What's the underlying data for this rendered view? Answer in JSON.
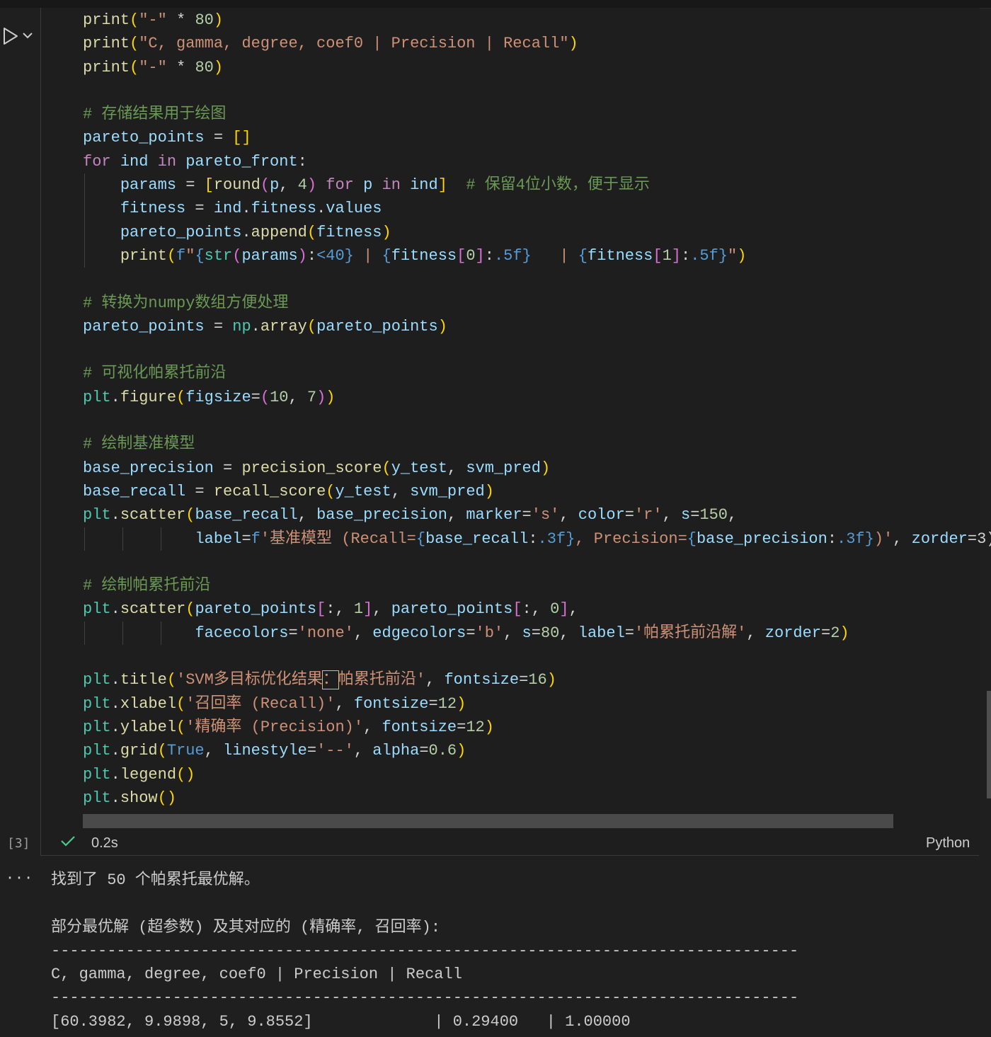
{
  "code_lines": [
    {
      "indent": 0,
      "segments": [
        [
          "f",
          "print"
        ],
        [
          "y",
          "("
        ],
        [
          "s",
          "\"-\""
        ],
        [
          "o",
          " * "
        ],
        [
          "n",
          "80"
        ],
        [
          "y",
          ")"
        ]
      ]
    },
    {
      "indent": 0,
      "segments": [
        [
          "f",
          "print"
        ],
        [
          "y",
          "("
        ],
        [
          "s",
          "\"C, gamma, degree, coef0 | Precision | Recall\""
        ],
        [
          "y",
          ")"
        ]
      ]
    },
    {
      "indent": 0,
      "segments": [
        [
          "f",
          "print"
        ],
        [
          "y",
          "("
        ],
        [
          "s",
          "\"-\""
        ],
        [
          "o",
          " * "
        ],
        [
          "n",
          "80"
        ],
        [
          "y",
          ")"
        ]
      ]
    },
    {
      "indent": 0,
      "segments": []
    },
    {
      "indent": 0,
      "segments": [
        [
          "c",
          "# 存储结果用于绘图"
        ]
      ]
    },
    {
      "indent": 0,
      "segments": [
        [
          "v",
          "pareto_points"
        ],
        [
          "o",
          " = "
        ],
        [
          "y",
          "[]"
        ]
      ]
    },
    {
      "indent": 0,
      "segments": [
        [
          "k",
          "for"
        ],
        [
          "o",
          " "
        ],
        [
          "v",
          "ind"
        ],
        [
          "o",
          " "
        ],
        [
          "k",
          "in"
        ],
        [
          "o",
          " "
        ],
        [
          "v",
          "pareto_front"
        ],
        [
          "o",
          ":"
        ]
      ]
    },
    {
      "indent": 1,
      "segments": [
        [
          "v",
          "params"
        ],
        [
          "o",
          " = "
        ],
        [
          "y",
          "["
        ],
        [
          "f",
          "round"
        ],
        [
          "m",
          "("
        ],
        [
          "v",
          "p"
        ],
        [
          "o",
          ", "
        ],
        [
          "n",
          "4"
        ],
        [
          "m",
          ")"
        ],
        [
          "o",
          " "
        ],
        [
          "k",
          "for"
        ],
        [
          "o",
          " "
        ],
        [
          "v",
          "p"
        ],
        [
          "o",
          " "
        ],
        [
          "k",
          "in"
        ],
        [
          "o",
          " "
        ],
        [
          "v",
          "ind"
        ],
        [
          "y",
          "]"
        ],
        [
          "o",
          "  "
        ],
        [
          "c",
          "# 保留4位小数，便于显示"
        ]
      ]
    },
    {
      "indent": 1,
      "segments": [
        [
          "v",
          "fitness"
        ],
        [
          "o",
          " = "
        ],
        [
          "v",
          "ind"
        ],
        [
          "o",
          "."
        ],
        [
          "v",
          "fitness"
        ],
        [
          "o",
          "."
        ],
        [
          "v",
          "values"
        ]
      ]
    },
    {
      "indent": 1,
      "segments": [
        [
          "v",
          "pareto_points"
        ],
        [
          "o",
          "."
        ],
        [
          "f",
          "append"
        ],
        [
          "y",
          "("
        ],
        [
          "v",
          "fitness"
        ],
        [
          "y",
          ")"
        ]
      ]
    },
    {
      "indent": 1,
      "segments": [
        [
          "f",
          "print"
        ],
        [
          "y",
          "("
        ],
        [
          "b",
          "f"
        ],
        [
          "s",
          "\""
        ],
        [
          "b",
          "{"
        ],
        [
          "t",
          "str"
        ],
        [
          "m",
          "("
        ],
        [
          "v",
          "params"
        ],
        [
          "m",
          ")"
        ],
        [
          "o",
          ":"
        ],
        [
          "b",
          "<40}"
        ],
        [
          "s",
          " | "
        ],
        [
          "b",
          "{"
        ],
        [
          "v",
          "fitness"
        ],
        [
          "m",
          "["
        ],
        [
          "n",
          "0"
        ],
        [
          "m",
          "]"
        ],
        [
          "o",
          ":"
        ],
        [
          "b",
          ".5f}"
        ],
        [
          "s",
          "   | "
        ],
        [
          "b",
          "{"
        ],
        [
          "v",
          "fitness"
        ],
        [
          "m",
          "["
        ],
        [
          "n",
          "1"
        ],
        [
          "m",
          "]"
        ],
        [
          "o",
          ":"
        ],
        [
          "b",
          ".5f}"
        ],
        [
          "s",
          "\""
        ],
        [
          "y",
          ")"
        ]
      ]
    },
    {
      "indent": 0,
      "segments": []
    },
    {
      "indent": 0,
      "segments": [
        [
          "c",
          "# 转换为numpy数组方便处理"
        ]
      ]
    },
    {
      "indent": 0,
      "segments": [
        [
          "v",
          "pareto_points"
        ],
        [
          "o",
          " = "
        ],
        [
          "t",
          "np"
        ],
        [
          "o",
          "."
        ],
        [
          "f",
          "array"
        ],
        [
          "y",
          "("
        ],
        [
          "v",
          "pareto_points"
        ],
        [
          "y",
          ")"
        ]
      ]
    },
    {
      "indent": 0,
      "segments": []
    },
    {
      "indent": 0,
      "segments": [
        [
          "c",
          "# 可视化帕累托前沿"
        ]
      ]
    },
    {
      "indent": 0,
      "segments": [
        [
          "t",
          "plt"
        ],
        [
          "o",
          "."
        ],
        [
          "f",
          "figure"
        ],
        [
          "y",
          "("
        ],
        [
          "v",
          "figsize"
        ],
        [
          "o",
          "="
        ],
        [
          "m",
          "("
        ],
        [
          "n",
          "10"
        ],
        [
          "o",
          ", "
        ],
        [
          "n",
          "7"
        ],
        [
          "m",
          ")"
        ],
        [
          "y",
          ")"
        ]
      ]
    },
    {
      "indent": 0,
      "segments": []
    },
    {
      "indent": 0,
      "segments": [
        [
          "c",
          "# 绘制基准模型"
        ]
      ]
    },
    {
      "indent": 0,
      "segments": [
        [
          "v",
          "base_precision"
        ],
        [
          "o",
          " = "
        ],
        [
          "f",
          "precision_score"
        ],
        [
          "y",
          "("
        ],
        [
          "v",
          "y_test"
        ],
        [
          "o",
          ", "
        ],
        [
          "v",
          "svm_pred"
        ],
        [
          "y",
          ")"
        ]
      ]
    },
    {
      "indent": 0,
      "segments": [
        [
          "v",
          "base_recall"
        ],
        [
          "o",
          " = "
        ],
        [
          "f",
          "recall_score"
        ],
        [
          "y",
          "("
        ],
        [
          "v",
          "y_test"
        ],
        [
          "o",
          ", "
        ],
        [
          "v",
          "svm_pred"
        ],
        [
          "y",
          ")"
        ]
      ]
    },
    {
      "indent": 0,
      "segments": [
        [
          "t",
          "plt"
        ],
        [
          "o",
          "."
        ],
        [
          "f",
          "scatter"
        ],
        [
          "y",
          "("
        ],
        [
          "v",
          "base_recall"
        ],
        [
          "o",
          ", "
        ],
        [
          "v",
          "base_precision"
        ],
        [
          "o",
          ", "
        ],
        [
          "v",
          "marker"
        ],
        [
          "o",
          "="
        ],
        [
          "s",
          "'s'"
        ],
        [
          "o",
          ", "
        ],
        [
          "v",
          "color"
        ],
        [
          "o",
          "="
        ],
        [
          "s",
          "'r'"
        ],
        [
          "o",
          ", "
        ],
        [
          "v",
          "s"
        ],
        [
          "o",
          "="
        ],
        [
          "n",
          "150"
        ],
        [
          "o",
          ","
        ]
      ]
    },
    {
      "indent": 3,
      "segments": [
        [
          "v",
          "label"
        ],
        [
          "o",
          "="
        ],
        [
          "b",
          "f"
        ],
        [
          "s",
          "'基准模型 (Recall="
        ],
        [
          "b",
          "{"
        ],
        [
          "v",
          "base_recall"
        ],
        [
          "o",
          ":"
        ],
        [
          "b",
          ".3f}"
        ],
        [
          "s",
          ", Precision="
        ],
        [
          "b",
          "{"
        ],
        [
          "v",
          "base_precision"
        ],
        [
          "o",
          ":"
        ],
        [
          "b",
          ".3f}"
        ],
        [
          "s",
          ")'"
        ],
        [
          "o",
          ", "
        ],
        [
          "v",
          "zorder"
        ],
        [
          "o",
          "=3)"
        ]
      ]
    },
    {
      "indent": 0,
      "segments": []
    },
    {
      "indent": 0,
      "segments": [
        [
          "c",
          "# 绘制帕累托前沿"
        ]
      ]
    },
    {
      "indent": 0,
      "segments": [
        [
          "t",
          "plt"
        ],
        [
          "o",
          "."
        ],
        [
          "f",
          "scatter"
        ],
        [
          "y",
          "("
        ],
        [
          "v",
          "pareto_points"
        ],
        [
          "m",
          "["
        ],
        [
          "o",
          ":, "
        ],
        [
          "n",
          "1"
        ],
        [
          "m",
          "]"
        ],
        [
          "o",
          ", "
        ],
        [
          "v",
          "pareto_points"
        ],
        [
          "m",
          "["
        ],
        [
          "o",
          ":, "
        ],
        [
          "n",
          "0"
        ],
        [
          "m",
          "]"
        ],
        [
          "o",
          ","
        ]
      ]
    },
    {
      "indent": 3,
      "segments": [
        [
          "v",
          "facecolors"
        ],
        [
          "o",
          "="
        ],
        [
          "s",
          "'none'"
        ],
        [
          "o",
          ", "
        ],
        [
          "v",
          "edgecolors"
        ],
        [
          "o",
          "="
        ],
        [
          "s",
          "'b'"
        ],
        [
          "o",
          ", "
        ],
        [
          "v",
          "s"
        ],
        [
          "o",
          "="
        ],
        [
          "n",
          "80"
        ],
        [
          "o",
          ", "
        ],
        [
          "v",
          "label"
        ],
        [
          "o",
          "="
        ],
        [
          "s",
          "'帕累托前沿解'"
        ],
        [
          "o",
          ", "
        ],
        [
          "v",
          "zorder"
        ],
        [
          "o",
          "="
        ],
        [
          "n",
          "2"
        ],
        [
          "y",
          ")"
        ]
      ]
    },
    {
      "indent": 0,
      "segments": []
    },
    {
      "indent": 0,
      "segments": [
        [
          "t",
          "plt"
        ],
        [
          "o",
          "."
        ],
        [
          "f",
          "title"
        ],
        [
          "y",
          "("
        ],
        [
          "s",
          "'SVM多目标优化结果"
        ],
        [
          "S",
          "："
        ],
        [
          "s",
          "帕累托前沿'"
        ],
        [
          "o",
          ", "
        ],
        [
          "v",
          "fontsize"
        ],
        [
          "o",
          "="
        ],
        [
          "n",
          "16"
        ],
        [
          "y",
          ")"
        ]
      ]
    },
    {
      "indent": 0,
      "segments": [
        [
          "t",
          "plt"
        ],
        [
          "o",
          "."
        ],
        [
          "f",
          "xlabel"
        ],
        [
          "y",
          "("
        ],
        [
          "s",
          "'召回率 (Recall)'"
        ],
        [
          "o",
          ", "
        ],
        [
          "v",
          "fontsize"
        ],
        [
          "o",
          "="
        ],
        [
          "n",
          "12"
        ],
        [
          "y",
          ")"
        ]
      ]
    },
    {
      "indent": 0,
      "segments": [
        [
          "t",
          "plt"
        ],
        [
          "o",
          "."
        ],
        [
          "f",
          "ylabel"
        ],
        [
          "y",
          "("
        ],
        [
          "s",
          "'精确率 (Precision)'"
        ],
        [
          "o",
          ", "
        ],
        [
          "v",
          "fontsize"
        ],
        [
          "o",
          "="
        ],
        [
          "n",
          "12"
        ],
        [
          "y",
          ")"
        ]
      ]
    },
    {
      "indent": 0,
      "segments": [
        [
          "t",
          "plt"
        ],
        [
          "o",
          "."
        ],
        [
          "f",
          "grid"
        ],
        [
          "y",
          "("
        ],
        [
          "b",
          "True"
        ],
        [
          "o",
          ", "
        ],
        [
          "v",
          "linestyle"
        ],
        [
          "o",
          "="
        ],
        [
          "s",
          "'--'"
        ],
        [
          "o",
          ", "
        ],
        [
          "v",
          "alpha"
        ],
        [
          "o",
          "="
        ],
        [
          "n",
          "0.6"
        ],
        [
          "y",
          ")"
        ]
      ]
    },
    {
      "indent": 0,
      "segments": [
        [
          "t",
          "plt"
        ],
        [
          "o",
          "."
        ],
        [
          "f",
          "legend"
        ],
        [
          "y",
          "()"
        ]
      ]
    },
    {
      "indent": 0,
      "segments": [
        [
          "t",
          "plt"
        ],
        [
          "o",
          "."
        ],
        [
          "f",
          "show"
        ],
        [
          "y",
          "()"
        ]
      ]
    }
  ],
  "cell": {
    "execution_count": "[3]",
    "duration": "0.2s",
    "language": "Python",
    "status": "success"
  },
  "output": {
    "more_label": "···",
    "lines": [
      "找到了 50 个帕累托最优解。",
      "",
      "部分最优解 (超参数) 及其对应的 (精确率, 召回率):",
      "--------------------------------------------------------------------------------",
      "C, gamma, degree, coef0 | Precision | Recall",
      "--------------------------------------------------------------------------------",
      "[60.3982, 9.9898, 5, 9.8552]             | 0.29400   | 1.00000"
    ]
  },
  "colors": {
    "background": "#1f1f1f",
    "keyword": "#c586c0",
    "function": "#dcdcaa",
    "string": "#ce9178",
    "number": "#b5cea8",
    "variable": "#9cdcfe",
    "comment": "#6a9955",
    "success_check": "#4ec98a"
  },
  "icons": {
    "run": "run-cell-icon",
    "chevron": "chevron-down-icon",
    "check": "check-icon",
    "more": "more-output-icon"
  }
}
